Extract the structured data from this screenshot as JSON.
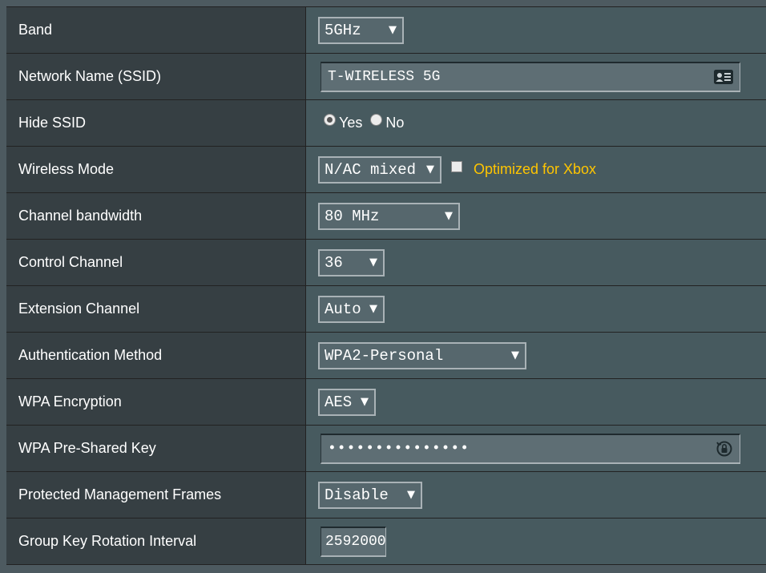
{
  "rows": [
    {
      "label": "Band",
      "select_value": "5GHz"
    },
    {
      "label": "Network Name (SSID)",
      "input_value": "T-WIRELESS 5G",
      "icon": "id-card-icon"
    },
    {
      "label": "Hide SSID",
      "options": [
        {
          "label": "Yes",
          "checked": true
        },
        {
          "label": "No",
          "checked": false
        }
      ]
    },
    {
      "label": "Wireless Mode",
      "select_value": "N/AC mixed",
      "checkbox_label": "Optimized for Xbox",
      "checkbox_checked": false
    },
    {
      "label": "Channel bandwidth",
      "select_value": "80 MHz"
    },
    {
      "label": "Control Channel",
      "select_value": "36"
    },
    {
      "label": "Extension Channel",
      "select_value": "Auto"
    },
    {
      "label": "Authentication Method",
      "select_value": "WPA2-Personal"
    },
    {
      "label": "WPA Encryption",
      "select_value": "AES"
    },
    {
      "label": "WPA Pre-Shared Key",
      "input_value": "•••••••••••••••",
      "icon": "password-reveal-icon"
    },
    {
      "label": "Protected Management Frames",
      "select_value": "Disable"
    },
    {
      "label": "Group Key Rotation Interval",
      "input_value": "2592000"
    }
  ],
  "dropdown_arrow": "▼",
  "colors": {
    "label_bg": "#363f43",
    "value_bg": "#475a5f",
    "accent": "#ffc500"
  }
}
